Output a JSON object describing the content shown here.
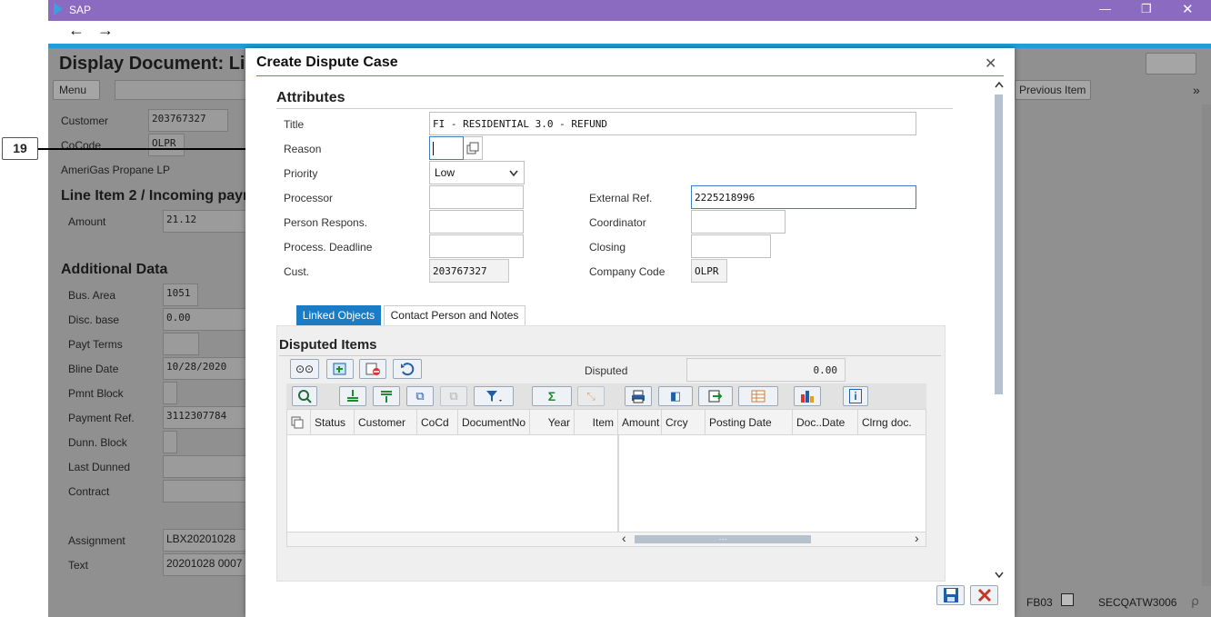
{
  "window": {
    "title": "SAP",
    "minimize": "—",
    "restore": "❐",
    "close": "✕"
  },
  "nav": {
    "back": "←",
    "forward": "→"
  },
  "annotation": {
    "number": "19"
  },
  "background": {
    "page_title": "Display Document: Li",
    "menu_label": "Menu",
    "previous_item": "Previous Item",
    "customer_label": "Customer",
    "customer_value": "203767327",
    "cocode_label": "CoCode",
    "cocode_value": "OLPR",
    "company_name": "AmeriGas Propane LP",
    "line_item_heading": "Line Item 2 / Incoming payr",
    "amount_label": "Amount",
    "amount_value": "21.12",
    "additional_heading": "Additional Data",
    "bus_area_label": "Bus. Area",
    "bus_area_value": "1051",
    "disc_base_label": "Disc. base",
    "disc_base_value": "0.00",
    "payt_terms_label": "Payt Terms",
    "bline_label": "Bline Date",
    "bline_value": "10/28/2020",
    "pmnt_block_label": "Pmnt Block",
    "payment_ref_label": "Payment Ref.",
    "payment_ref_value": "3112307784",
    "dunn_block_label": "Dunn. Block",
    "last_dunned_label": "Last Dunned",
    "contract_label": "Contract",
    "assignment_label": "Assignment",
    "assignment_value": "LBX20201028",
    "text_label": "Text",
    "text_value": "20201028 0007",
    "status_tcode": "FB03",
    "status_server": "SECQATW3006"
  },
  "dialog": {
    "title": "Create Dispute Case",
    "close": "✕",
    "attributes_heading": "Attributes",
    "title_label": "Title",
    "title_value": "FI - RESIDENTIAL 3.0 - REFUND",
    "reason_label": "Reason",
    "reason_value": "",
    "priority_label": "Priority",
    "priority_value": "Low",
    "processor_label": "Processor",
    "processor_value": "",
    "external_ref_label": "External Ref.",
    "external_ref_value": "2225218996",
    "person_respons_label": "Person Respons.",
    "person_respons_value": "",
    "coordinator_label": "Coordinator",
    "coordinator_value": "",
    "deadline_label": "Process. Deadline",
    "deadline_value": "",
    "closing_label": "Closing",
    "closing_value": "",
    "cust_label": "Cust.",
    "cust_value": "203767327",
    "company_code_label": "Company Code",
    "company_code_value": "OLPR",
    "tabs": [
      {
        "label": "Linked Objects",
        "active": true
      },
      {
        "label": "Contact Person and Notes",
        "active": false
      }
    ],
    "disputed_heading": "Disputed Items",
    "disputed_label": "Disputed",
    "disputed_value": "0.00",
    "columns": [
      "Status",
      "Customer",
      "CoCd",
      "DocumentNo",
      "Year",
      "Item",
      "Amount",
      "Crcy",
      "Posting Date",
      "Doc..Date",
      "Clrng doc."
    ],
    "scroll_left": "‹",
    "scroll_right": "›",
    "scroll_thumb": "⋯"
  },
  "colors": {
    "accent": "#1e9fd6",
    "titlebar": "#8b6bbf",
    "active_tab": "#1a7cc4",
    "cancel": "#c0392b",
    "save": "#1f5fa8"
  }
}
